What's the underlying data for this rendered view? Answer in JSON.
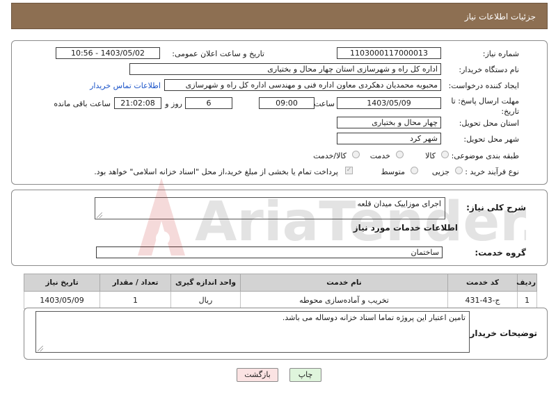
{
  "header": {
    "title": "جزئیات اطلاعات نیاز"
  },
  "form": {
    "need_number_label": "شماره نیاز:",
    "need_number": "1103000117000013",
    "announce_label": "تاریخ و ساعت اعلان عمومی:",
    "announce_value": "1403/05/02 - 10:56",
    "buyer_label": "نام دستگاه خریدار:",
    "buyer_value": "اداره کل راه و شهرسازی استان چهار محال و بختیاری",
    "creator_label": "ایجاد کننده درخواست:",
    "creator_value": "محبوبه محمدیان دهکردی معاون اداره فنی و مهندسی اداره کل راه و شهرسازی",
    "contact_link": "اطلاعات تماس خریدار",
    "deadline_label": "مهلت ارسال پاسخ: تا تاریخ:",
    "deadline_date": "1403/05/09",
    "time_label": "ساعت",
    "deadline_time": "09:00",
    "days_value": "6",
    "days_label": "روز و",
    "remaining_value": "21:02:08",
    "remaining_label": "ساعت باقی مانده",
    "province_label": "استان محل تحویل:",
    "province_value": "چهار محال و بختیاری",
    "city_label": "شهر محل تحویل:",
    "city_value": "شهر کرد",
    "category_label": "طبقه بندی موضوعی:",
    "category_options": [
      "کالا",
      "خدمت",
      "کالا/خدمت"
    ],
    "process_label": "نوع فرآیند خرید :",
    "process_options": [
      "جزیی",
      "متوسط"
    ],
    "payment_text": "پرداخت تمام یا بخشی از مبلغ خرید،از محل \"اسناد خزانه اسلامی\" خواهد بود."
  },
  "summary": {
    "label": "شرح کلی نیاز:",
    "value": "اجرای موزاییک میدان قلعه",
    "services_title": "اطلاعات خدمات مورد نیاز",
    "group_label": "گروه خدمت:",
    "group_value": "ساختمان"
  },
  "table": {
    "headers": [
      "ردیف",
      "کد خدمت",
      "نام خدمت",
      "واحد اندازه گیری",
      "تعداد / مقدار",
      "تاریخ نیاز"
    ],
    "rows": [
      [
        "1",
        "ج-43-431",
        "تخریب و آماده‌سازی محوطه",
        "ریال",
        "1",
        "1403/05/09"
      ]
    ]
  },
  "notes": {
    "label": "توضیحات خریدار:",
    "value": "تامین اعتبار این پروژه تماما اسناد خزانه دوساله می باشد."
  },
  "buttons": {
    "print": "چاپ",
    "back": "بازگشت"
  },
  "watermark": "AriaTender.neT"
}
